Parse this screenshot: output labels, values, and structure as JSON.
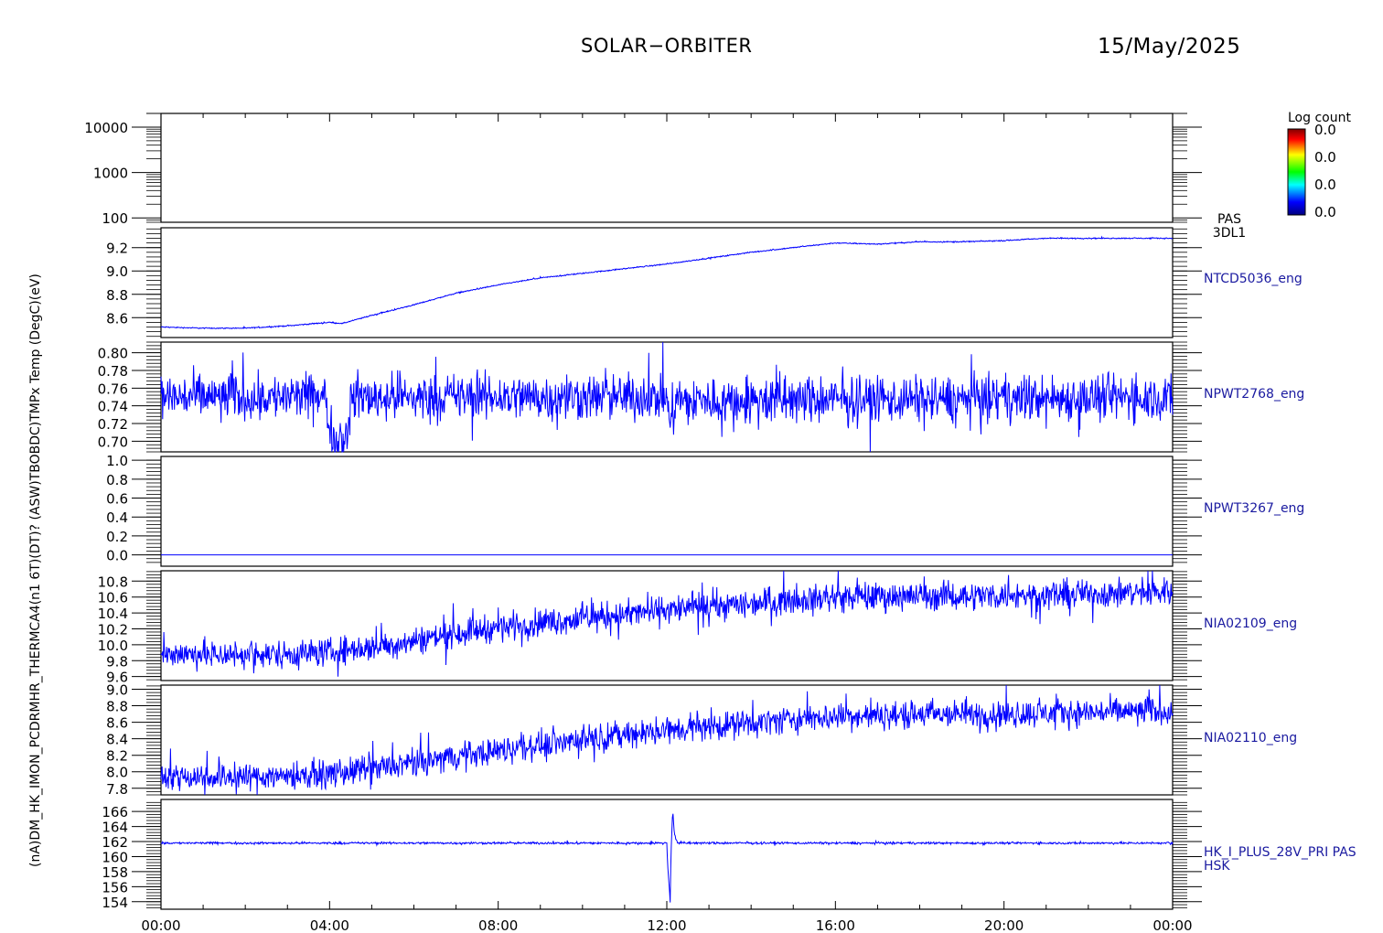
{
  "header": {
    "mission": "SOLAR−ORBITER",
    "date": "15/May/2025"
  },
  "colorbar": {
    "title": "Log count",
    "ticks": [
      "0.0",
      "0.0",
      "0.0",
      "0.0"
    ]
  },
  "left_axis_label": "(nA)DM_HK_IMON_PCDRMHR_THERMCA4(n1 6T)(DT)? (ASW)TBOBDC)TMPx Temp (DegC)(eV)",
  "x_axis": {
    "ticks": [
      "00:00",
      "04:00",
      "08:00",
      "12:00",
      "16:00",
      "20:00",
      "00:00"
    ]
  },
  "colors": {
    "trace": "#0000ff",
    "label": "#1a1aa0",
    "axis": "#000000"
  },
  "chart_data": [
    {
      "type": "heatmap",
      "yscale": "log",
      "ylim": [
        80,
        20000
      ],
      "ytick_labels": [
        "10000",
        "1000",
        "100"
      ],
      "ytick_values": [
        10000,
        1000,
        100
      ],
      "side_label": [
        "PAS",
        "3DL1"
      ],
      "values": []
    },
    {
      "type": "line",
      "ylim": [
        8.43,
        9.37
      ],
      "ytick_labels": [
        "9.2",
        "9.0",
        "8.8",
        "8.6"
      ],
      "ytick_values": [
        9.2,
        9.0,
        8.8,
        8.6
      ],
      "side_label": [
        "NTCD5036_eng"
      ],
      "noise": 0.004,
      "x": [
        0,
        1,
        2,
        3,
        4,
        4.3,
        5,
        6,
        7,
        8,
        9,
        10,
        11,
        12,
        13,
        14,
        15,
        16,
        17,
        18,
        19,
        20,
        21,
        22,
        23,
        24
      ],
      "y": [
        8.52,
        8.51,
        8.51,
        8.53,
        8.56,
        8.55,
        8.62,
        8.71,
        8.81,
        8.88,
        8.94,
        8.98,
        9.02,
        9.06,
        9.11,
        9.16,
        9.2,
        9.24,
        9.23,
        9.25,
        9.25,
        9.26,
        9.28,
        9.28,
        9.28,
        9.28
      ]
    },
    {
      "type": "line",
      "ylim": [
        0.688,
        0.812
      ],
      "ytick_labels": [
        "0.80",
        "0.78",
        "0.76",
        "0.74",
        "0.72",
        "0.70"
      ],
      "ytick_values": [
        0.8,
        0.78,
        0.76,
        0.74,
        0.72,
        0.7
      ],
      "side_label": [
        "NPWT2768_eng"
      ],
      "noise": 0.022,
      "x": [
        0,
        3.9,
        4.0,
        4.1,
        4.4,
        4.5,
        12.0,
        12.1,
        12.2,
        24
      ],
      "y": [
        0.75,
        0.75,
        0.715,
        0.705,
        0.705,
        0.75,
        0.75,
        0.725,
        0.745,
        0.75
      ]
    },
    {
      "type": "line",
      "ylim": [
        -0.12,
        1.04
      ],
      "ytick_labels": [
        "1.0",
        "0.8",
        "0.6",
        "0.4",
        "0.2",
        "0.0"
      ],
      "ytick_values": [
        1.0,
        0.8,
        0.6,
        0.4,
        0.2,
        0.0
      ],
      "side_label": [
        "NPWT3267_eng"
      ],
      "noise": 0.0,
      "x": [
        0,
        24
      ],
      "y": [
        0.0,
        0.0
      ]
    },
    {
      "type": "line",
      "ylim": [
        9.55,
        10.93
      ],
      "ytick_labels": [
        "10.8",
        "10.6",
        "10.4",
        "10.2",
        "10.0",
        "9.8",
        "9.6"
      ],
      "ytick_values": [
        10.8,
        10.6,
        10.4,
        10.2,
        10.0,
        9.8,
        9.6
      ],
      "side_label": [
        "NIA02109_eng"
      ],
      "noise": 0.15,
      "x": [
        0,
        2,
        4,
        5,
        6,
        7,
        8,
        9,
        10,
        11,
        12,
        13,
        14,
        15,
        16,
        18,
        20,
        22,
        24
      ],
      "y": [
        9.89,
        9.87,
        9.91,
        9.97,
        10.05,
        10.15,
        10.22,
        10.28,
        10.33,
        10.38,
        10.44,
        10.48,
        10.52,
        10.57,
        10.6,
        10.61,
        10.62,
        10.64,
        10.67
      ]
    },
    {
      "type": "line",
      "ylim": [
        7.72,
        9.05
      ],
      "ytick_labels": [
        "9.0",
        "8.8",
        "8.6",
        "8.4",
        "8.2",
        "8.0",
        "7.8"
      ],
      "ytick_values": [
        9.0,
        8.8,
        8.6,
        8.4,
        8.2,
        8.0,
        7.8
      ],
      "side_label": [
        "NIA02110_eng"
      ],
      "noise": 0.14,
      "x": [
        0,
        2,
        4,
        5,
        6,
        7,
        8,
        9,
        10,
        11,
        12,
        13,
        14,
        15,
        16,
        18,
        20,
        22,
        24
      ],
      "y": [
        7.95,
        7.94,
        7.97,
        8.03,
        8.1,
        8.19,
        8.26,
        8.33,
        8.4,
        8.45,
        8.5,
        8.55,
        8.59,
        8.64,
        8.67,
        8.69,
        8.7,
        8.72,
        8.74
      ]
    },
    {
      "type": "line",
      "ylim": [
        153.0,
        167.6
      ],
      "ytick_labels": [
        "166",
        "164",
        "162",
        "160",
        "158",
        "156",
        "154"
      ],
      "ytick_values": [
        166,
        164,
        162,
        160,
        158,
        156,
        154
      ],
      "side_label": [
        "HK_I_PLUS_28V_PRI PAS",
        "HSK"
      ],
      "noise": 0.12,
      "x": [
        0,
        12.0,
        12.02,
        12.08,
        12.1,
        12.14,
        12.18,
        12.25,
        24
      ],
      "y": [
        161.8,
        161.8,
        159.0,
        154.0,
        160.5,
        166.2,
        163.0,
        161.8,
        161.8
      ]
    }
  ]
}
